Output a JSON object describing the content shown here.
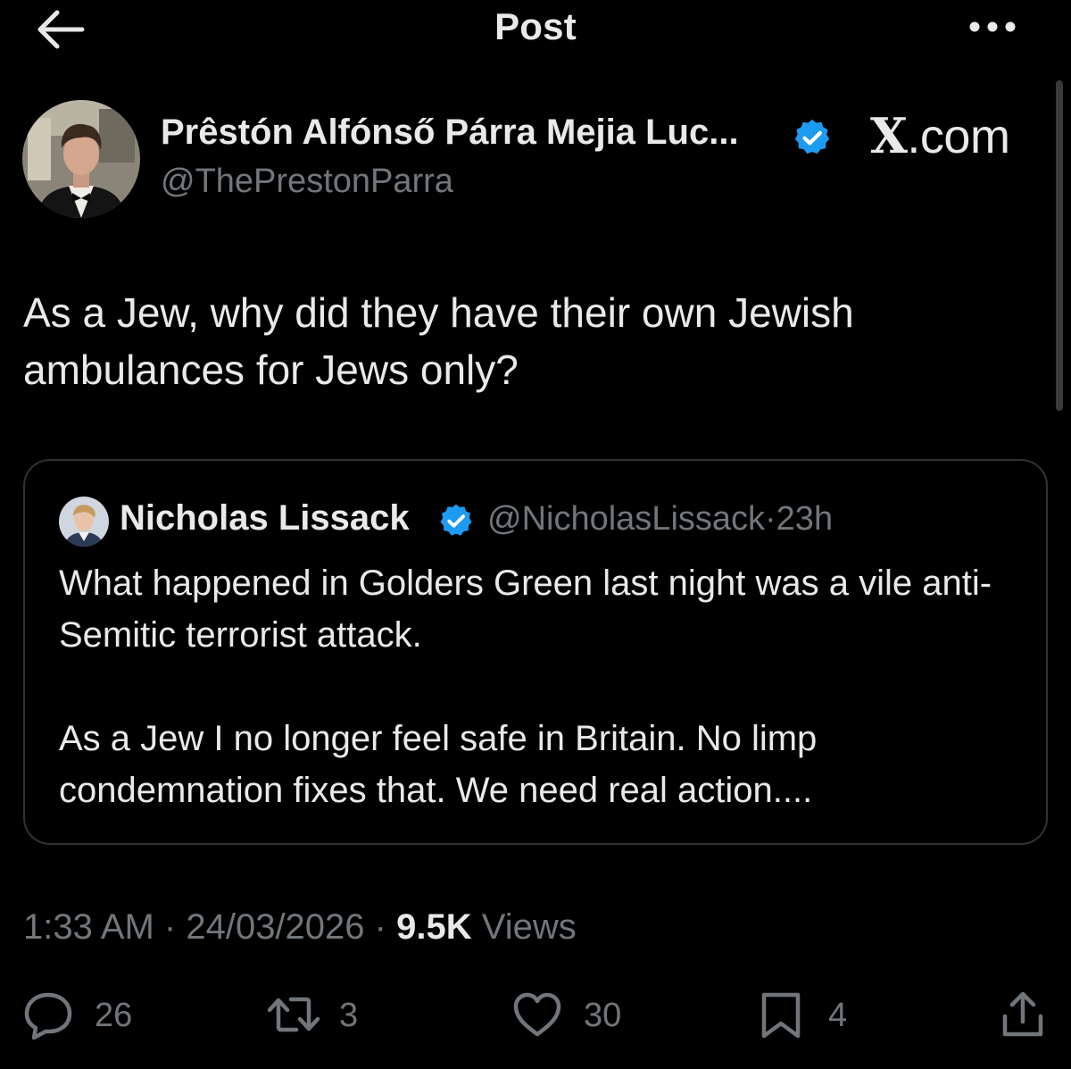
{
  "header": {
    "title": "Post",
    "back_icon": "arrow-left-icon",
    "more_icon": "more-horizontal-icon"
  },
  "watermark": {
    "x": "X",
    "suffix": ".com"
  },
  "author": {
    "name": "Prêstón Alfónső Párra Mejia Luc...",
    "handle": "@ThePrestonParra",
    "verified": true
  },
  "post": {
    "text": "As a Jew, why did they have their own Jewish ambulances for Jews only?"
  },
  "quote": {
    "name": "Nicholas Lissack",
    "handle": "@NicholasLissack",
    "separator": "·",
    "time": "23h",
    "verified": true,
    "text": "What happened in Golders Green last night was a vile anti-Semitic terrorist attack.\n\nAs a Jew I no longer feel safe in Britain. No limp condemnation fixes that. We need real action...."
  },
  "meta": {
    "time": "1:33 AM",
    "separator": "·",
    "date": "24/03/2026",
    "views_count": "9.5K",
    "views_label": "Views"
  },
  "actions": {
    "replies": "26",
    "reposts": "3",
    "likes": "30",
    "bookmarks": "4"
  },
  "colors": {
    "background": "#000000",
    "text": "#e7e9ea",
    "muted": "#71767b",
    "border": "#2f3336",
    "verified": "#1d9bf0"
  }
}
